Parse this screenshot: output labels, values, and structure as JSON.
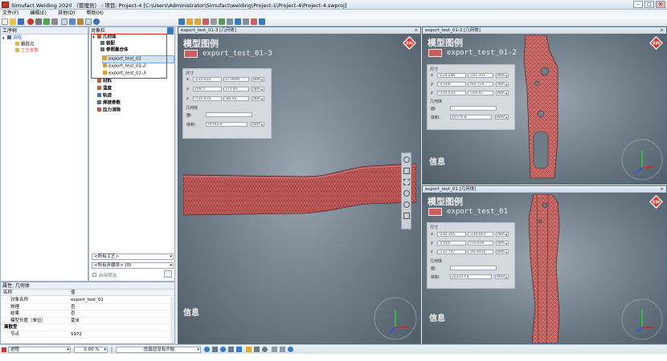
{
  "window": {
    "title": "Simufact Welding 2020 （管理员） : 项目: Project-4 [C:\\Users\\Administrator\\Simufact\\welding\\Project-1\\Project-4\\Project-4.swproj]"
  },
  "menu": [
    "文件(F)",
    "编辑(E)",
    "其他(D)",
    "帮助(H)"
  ],
  "process_tree": {
    "header": "工序树",
    "items": [
      {
        "label": "进程"
      },
      {
        "label": "跟踪点"
      },
      {
        "label": "工艺参数"
      }
    ]
  },
  "object_tree": {
    "header": "对象栏",
    "items": [
      {
        "label": "几何体"
      },
      {
        "label": "装配"
      },
      {
        "label": "参照集合体"
      },
      {
        "label": "export_test_01"
      },
      {
        "label": "export_test_01-2"
      },
      {
        "label": "export_test_01-3"
      },
      {
        "label": "材料"
      },
      {
        "label": "温度"
      },
      {
        "label": "轨迹"
      },
      {
        "label": "焊接参数"
      },
      {
        "label": "应力消除"
      }
    ],
    "filters": [
      "<所有工艺>",
      "<所有步骤序> (0)"
    ],
    "apply_filter": "启用筛选"
  },
  "properties": {
    "header": "属性: 几何体",
    "columns": [
      "名称",
      "值"
    ],
    "rows": [
      {
        "key": "对象名称",
        "value": "export_test_01"
      },
      {
        "key": "物理",
        "value": "否"
      },
      {
        "key": "结果",
        "value": "否"
      },
      {
        "key": "模型长度（单位）",
        "value": "毫米"
      },
      {
        "key": "离散型",
        "value": ""
      },
      {
        "key": "节点",
        "value": "5972"
      }
    ]
  },
  "viewports": [
    {
      "title": "export_test_01-3 [几何体]",
      "legend_title": "模型图例",
      "model_name": "export_test_01-3",
      "info": "信息",
      "panel": {
        "dims_label": "尺寸",
        "rows": [
          {
            "axis": "x",
            "min": "-233.910",
            "max": "57.9090",
            "unit": "mm"
          },
          {
            "axis": "y",
            "min": "209.5",
            "max": "271.65",
            "unit": "mm"
          },
          {
            "axis": "z",
            "min": "-130.876",
            "max": "-86.95",
            "unit": "mm"
          }
        ],
        "geom_label": "几何体",
        "area_label": "面:",
        "area_value": "",
        "volume_label": "体积:",
        "volume_value": "79762.0",
        "volume_unit": "mm³"
      }
    },
    {
      "title": "export_test_01-2 [几何体]",
      "legend_title": "模型图例",
      "model_name": "export_test_01-2",
      "info": "信息",
      "panel": {
        "dims_label": "尺寸",
        "rows": [
          {
            "axis": "x",
            "min": "-218.286",
            "max": "-141.351",
            "unit": "mm"
          },
          {
            "axis": "y",
            "min": "-0.000",
            "max": "295.729",
            "unit": "mm"
          },
          {
            "axis": "z",
            "min": "-120.023",
            "max": "-109.91",
            "unit": "mm"
          }
        ],
        "geom_label": "几何体",
        "area_label": "面:",
        "area_value": "",
        "volume_label": "体积:",
        "volume_value": "40176.8",
        "volume_unit": "mm³"
      }
    },
    {
      "title": "export_test_01 [几何体]",
      "legend_title": "模型图例",
      "model_name": "export_test_01",
      "info": "信息",
      "panel": {
        "dims_label": "尺寸",
        "rows": [
          {
            "axis": "x",
            "min": "-238.365",
            "max": "-138.863",
            "unit": "mm"
          },
          {
            "axis": "y",
            "min": "-0.000",
            "max": "276.699",
            "unit": "mm"
          },
          {
            "axis": "z",
            "min": "-132.707",
            "max": "-36.9456",
            "unit": "mm"
          }
        ],
        "geom_label": "几何体",
        "area_label": "面:",
        "area_value": "",
        "volume_label": "体积:",
        "volume_value": "222253.8",
        "volume_unit": "mm³"
      }
    }
  ],
  "statusbar": {
    "process": "进程",
    "progress": "0.00 %",
    "message": "仿真还没有开始"
  },
  "colors": {
    "mesh_fill": "#c9605f",
    "mesh_line": "#6e2a2a",
    "highlight_box": "#e0241e",
    "viewport_border": "#4a6e92"
  }
}
